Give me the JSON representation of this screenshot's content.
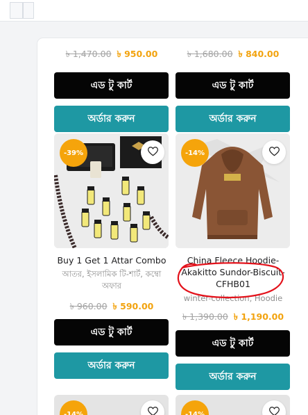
{
  "products_top": [
    {
      "old_price": "৳ 1,470.00",
      "new_price": "৳ 950.00",
      "cart_label": "এড টু কার্ট",
      "order_label": "অর্ডার করুন"
    },
    {
      "old_price": "৳ 1,680.00",
      "new_price": "৳ 840.00",
      "cart_label": "এড টু কার্ট",
      "order_label": "অর্ডার করুন"
    }
  ],
  "products": [
    {
      "discount": "-39%",
      "title": "Buy 1 Get 1 Attar Combo",
      "categories": "আতর, ইসলামিক টি-শার্ট, কম্বো অফার",
      "old_price": "৳ 960.00",
      "new_price": "৳ 590.00",
      "cart_label": "এড টু কার্ট",
      "order_label": "অর্ডার করুন",
      "image_icon": "attar-bottles-image"
    },
    {
      "discount": "-14%",
      "title": "China Fleece Hoodie-Akakitto Sundor-Biscuit-CFHB01",
      "categories": "winter-collection, Hoodie",
      "old_price": "৳ 1,390.00",
      "new_price": "৳ 1,190.00",
      "cart_label": "এড টু কার্ট",
      "order_label": "অর্ডার করুন",
      "image_icon": "brown-hoodie-image"
    }
  ],
  "products_bottom": [
    {
      "discount": "-14%"
    },
    {
      "discount": "-14%"
    }
  ],
  "colors": {
    "accent_price": "#f2a30f",
    "cart_button": "#050505",
    "order_button": "#1e98a3",
    "discount_badge": "#f5a40b",
    "annotation_red": "#e3121b"
  },
  "icons": {
    "wishlist": "heart-icon"
  }
}
